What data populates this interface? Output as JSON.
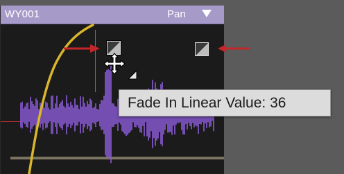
{
  "clip": {
    "name": "WY001",
    "pan_label": "Pan",
    "header_color": "#a59ac8",
    "waveform_color": "#8a5bd6",
    "fade_curve_color": "#d9b62d"
  },
  "tooltip": {
    "text": "Fade In Linear Value: 36"
  },
  "annotations": {
    "arrow_color": "#c4262a"
  },
  "icons": {
    "pan_menu": "triangle-down-icon",
    "fade_in_handle": "fade-in-handle-icon",
    "fade_out_handle": "fade-out-handle-icon",
    "cursor": "move-cursor-icon",
    "fade_shape_indicator": "fade-shape-triangle-icon"
  }
}
